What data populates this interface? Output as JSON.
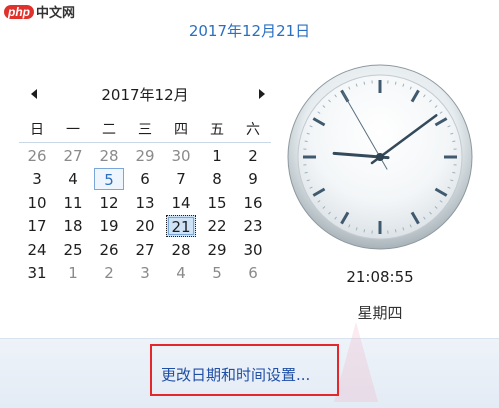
{
  "watermark": {
    "logo": "php",
    "text": "中文网"
  },
  "header": {
    "date": "2017年12月21日"
  },
  "calendar": {
    "month_label": "2017年12月",
    "prev_icon": "chevron-left-icon",
    "next_icon": "chevron-right-icon",
    "weekdays": [
      "日",
      "一",
      "二",
      "三",
      "四",
      "五",
      "六"
    ],
    "weeks": [
      [
        {
          "d": "26",
          "o": true
        },
        {
          "d": "27",
          "o": true
        },
        {
          "d": "28",
          "o": true
        },
        {
          "d": "29",
          "o": true
        },
        {
          "d": "30",
          "o": true
        },
        {
          "d": "1"
        },
        {
          "d": "2"
        }
      ],
      [
        {
          "d": "3"
        },
        {
          "d": "4"
        },
        {
          "d": "5",
          "today": true
        },
        {
          "d": "6"
        },
        {
          "d": "7"
        },
        {
          "d": "8"
        },
        {
          "d": "9"
        }
      ],
      [
        {
          "d": "10"
        },
        {
          "d": "11"
        },
        {
          "d": "12"
        },
        {
          "d": "13"
        },
        {
          "d": "14"
        },
        {
          "d": "15"
        },
        {
          "d": "16"
        }
      ],
      [
        {
          "d": "17"
        },
        {
          "d": "18"
        },
        {
          "d": "19"
        },
        {
          "d": "20"
        },
        {
          "d": "21",
          "selected": true
        },
        {
          "d": "22"
        },
        {
          "d": "23"
        }
      ],
      [
        {
          "d": "24"
        },
        {
          "d": "25"
        },
        {
          "d": "26"
        },
        {
          "d": "27"
        },
        {
          "d": "28"
        },
        {
          "d": "29"
        },
        {
          "d": "30"
        }
      ],
      [
        {
          "d": "31"
        },
        {
          "d": "1",
          "o": true
        },
        {
          "d": "2",
          "o": true
        },
        {
          "d": "3",
          "o": true
        },
        {
          "d": "4",
          "o": true
        },
        {
          "d": "5",
          "o": true
        },
        {
          "d": "6",
          "o": true
        }
      ]
    ]
  },
  "clock": {
    "time": "21:08:55",
    "hours": 21,
    "minutes": 8,
    "seconds": 55,
    "weekday": "星期四"
  },
  "footer": {
    "link": "更改日期和时间设置..."
  },
  "colors": {
    "accent": "#2a6fc0",
    "link": "#1f4fa6",
    "highlight_box": "#e3272a"
  }
}
